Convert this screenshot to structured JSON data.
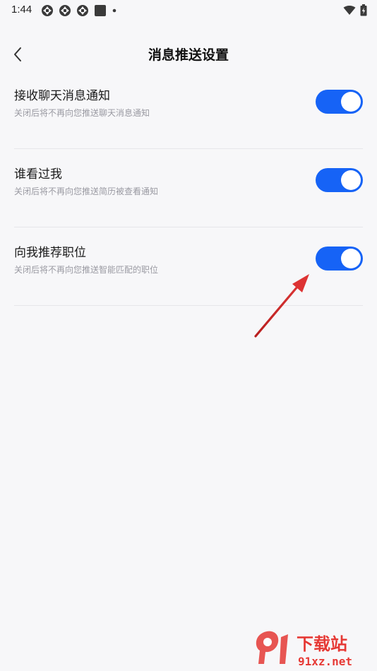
{
  "status_bar": {
    "time": "1:44",
    "left_icons": [
      "aperture-icon",
      "aperture-icon",
      "aperture-icon",
      "square-icon",
      "dot-icon"
    ],
    "right_icons": [
      "wifi-icon",
      "battery-icon"
    ]
  },
  "nav": {
    "back_icon": "chevron-left-icon",
    "title": "消息推送设置"
  },
  "settings": [
    {
      "title": "接收聊天消息通知",
      "desc": "关闭后将不再向您推送聊天消息通知",
      "enabled": true
    },
    {
      "title": "谁看过我",
      "desc": "关闭后将不再向您推送简历被查看通知",
      "enabled": true
    },
    {
      "title": "向我推荐职位",
      "desc": "关闭后将不再向您推送智能匹配的职位",
      "enabled": true
    }
  ],
  "colors": {
    "accent": "#1663f6",
    "background": "#f7f7f9",
    "divider": "#e6e6ea",
    "arrow": "#d42a2a",
    "watermark_red": "#e53935"
  },
  "watermark": {
    "logo_text": "下载站",
    "domain": "91xz.net"
  }
}
